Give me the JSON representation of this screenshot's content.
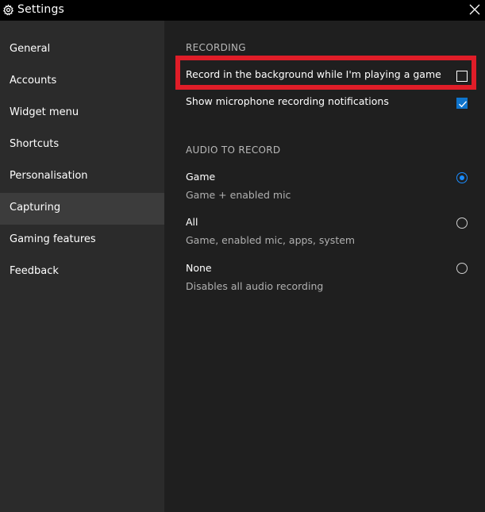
{
  "window": {
    "title": "Settings",
    "title_icon": "gear-icon",
    "close_icon": "close-icon"
  },
  "sidebar": {
    "items": [
      {
        "label": "General"
      },
      {
        "label": "Accounts"
      },
      {
        "label": "Widget menu"
      },
      {
        "label": "Shortcuts"
      },
      {
        "label": "Personalisation"
      },
      {
        "label": "Capturing"
      },
      {
        "label": "Gaming features"
      },
      {
        "label": "Feedback"
      }
    ]
  },
  "recording": {
    "header": "RECORDING",
    "background_record": {
      "label": "Record in the background while I'm playing a game",
      "checked": false
    },
    "mic_notifications": {
      "label": "Show microphone recording notifications",
      "checked": true
    }
  },
  "audio": {
    "header": "AUDIO TO RECORD",
    "options": [
      {
        "label": "Game",
        "description": "Game + enabled mic",
        "selected": true
      },
      {
        "label": "All",
        "description": "Game, enabled mic, apps, system",
        "selected": false
      },
      {
        "label": "None",
        "description": "Disables all audio recording",
        "selected": false
      }
    ]
  },
  "colors": {
    "accent": "#1a8cff",
    "checkbox_checked": "#0f74cc",
    "highlight": "#e01d28",
    "sidebar_bg": "#2b2b2b",
    "sidebar_selected": "#3c3c3c",
    "content_bg": "#1f1f1f",
    "titlebar_bg": "#000000"
  }
}
